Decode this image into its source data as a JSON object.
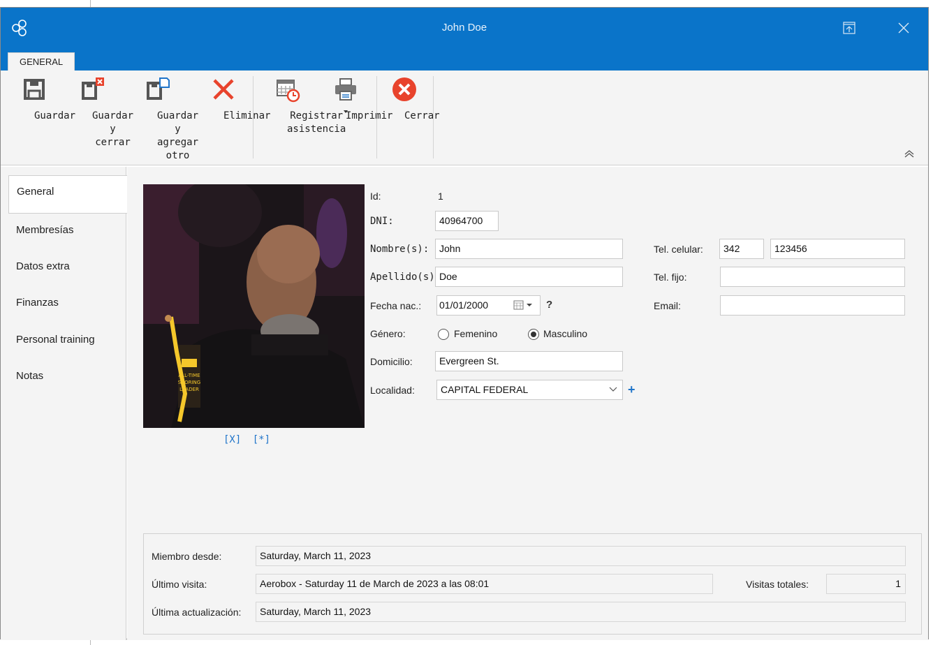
{
  "window": {
    "title": "John Doe"
  },
  "ribbon": {
    "tab": "GENERAL",
    "buttons": {
      "save": "Guardar",
      "save_close": "Guardar\ny cerrar",
      "save_add": "Guardar y\nagregar otro",
      "delete": "Eliminar",
      "attendance": "Registrar\nasistencia",
      "print": "Imprimir",
      "close": "Cerrar"
    }
  },
  "sidebar": {
    "items": [
      {
        "label": "General"
      },
      {
        "label": "Membresías"
      },
      {
        "label": "Datos extra"
      },
      {
        "label": "Finanzas"
      },
      {
        "label": "Personal training"
      },
      {
        "label": "Notas"
      }
    ]
  },
  "photo": {
    "remove_link": "[X]",
    "change_link": "[*]",
    "overlay_lines": [
      "ALL-TIME",
      "SCORING",
      "LEADER"
    ]
  },
  "form": {
    "id_label": "Id:",
    "id_value": "1",
    "dni_label": "DNI:",
    "dni_value": "40964700",
    "nombre_label": "Nombre(s):",
    "nombre_value": "John",
    "apellido_label": "Apellido(s):",
    "apellido_value": "Doe",
    "fecha_label": "Fecha nac.:",
    "fecha_value": "01/01/2000",
    "fecha_help": "?",
    "genero_label": "Género:",
    "genero_f": "Femenino",
    "genero_m": "Masculino",
    "genero_selected": "Masculino",
    "domicilio_label": "Domicilio:",
    "domicilio_value": "Evergreen St.",
    "localidad_label": "Localidad:",
    "localidad_value": "CAPITAL FEDERAL",
    "localidad_add": "+",
    "tel_cel_label": "Tel. celular:",
    "tel_cel_area": "342",
    "tel_cel_number": "123456",
    "tel_fijo_label": "Tel. fijo:",
    "tel_fijo_value": "",
    "email_label": "Email:",
    "email_value": ""
  },
  "summary": {
    "miembro_label": "Miembro desde:",
    "miembro_value": "Saturday, March 11, 2023",
    "ultimo_label": "Último visita:",
    "ultimo_value": "Aerobox - Saturday 11 de March de 2023 a las 08:01",
    "visitas_label": "Visitas totales:",
    "visitas_value": "1",
    "actualizacion_label": "Última actualización:",
    "actualizacion_value": "Saturday, March 11, 2023"
  },
  "colors": {
    "titlebar": "#0a74c9",
    "link": "#1f74c9",
    "delete": "#e8432c",
    "close": "#e8432c"
  }
}
